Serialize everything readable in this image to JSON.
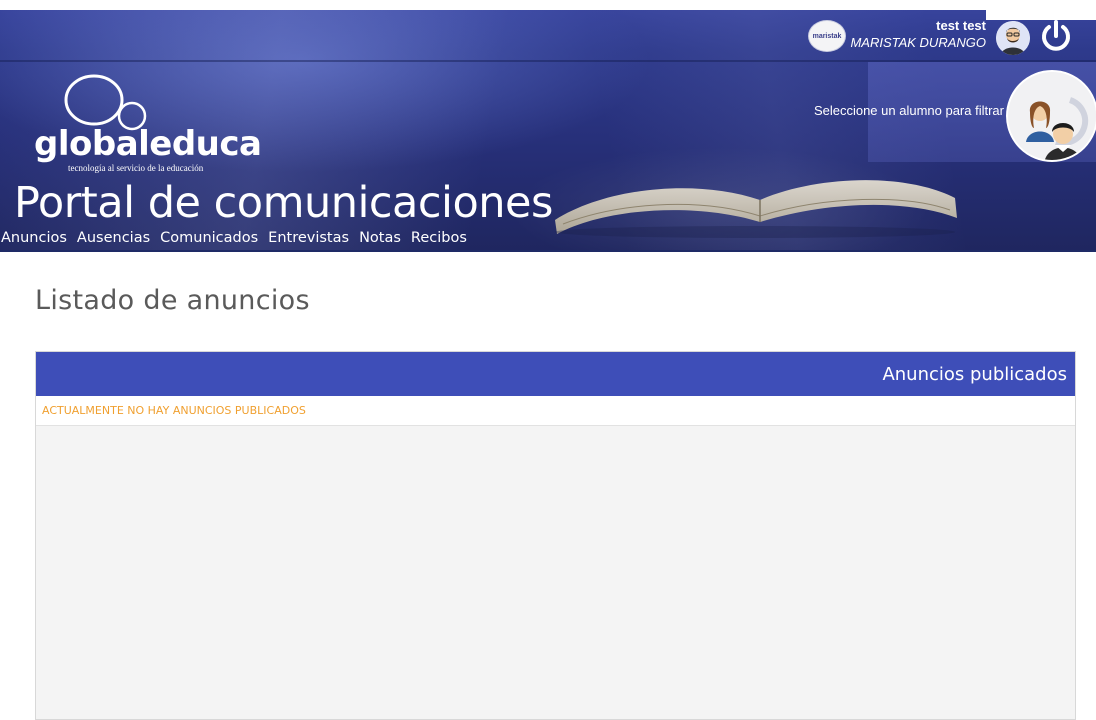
{
  "header": {
    "user_name": "test test",
    "school_name": "MARISTAK DURANGO",
    "school_logo_text": "maristak",
    "logo_text": "globaleduca",
    "logo_tagline": "tecnología al servicio de la educación",
    "filter_label": "Seleccione un alumno para filtrar",
    "portal_title": "Portal de comunicaciones",
    "nav": [
      "Anuncios",
      "Ausencias",
      "Comunicados",
      "Entrevistas",
      "Notas",
      "Recibos"
    ]
  },
  "main": {
    "heading": "Listado de anuncios",
    "panel_title": "Anuncios publicados",
    "empty_message": "ACTUALMENTE NO HAY ANUNCIOS PUBLICADOS"
  },
  "colors": {
    "brand_blue": "#3e4eb8",
    "warning_orange": "#f0a030"
  }
}
